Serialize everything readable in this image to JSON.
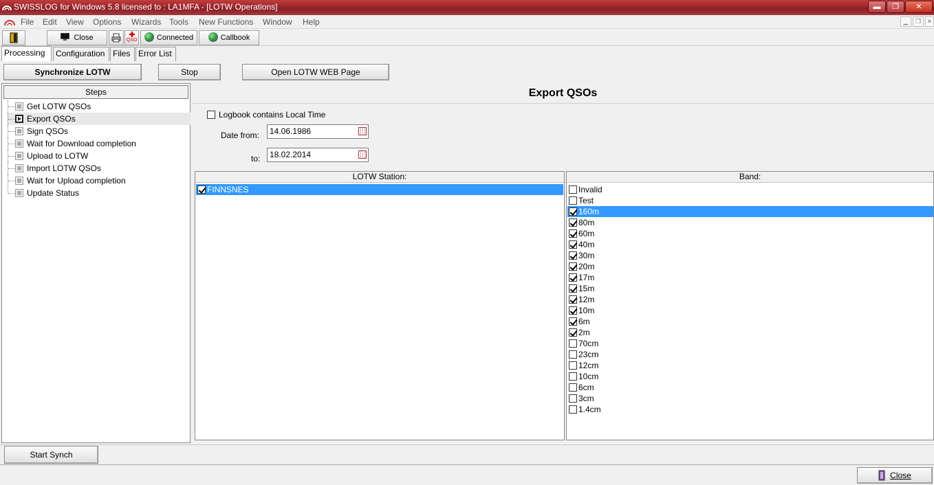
{
  "window": {
    "title": "SWISSLOG for Windows 5.8 licensed to : LA1MFA - [LOTW Operations]",
    "minimize": "▬",
    "maximize": "❐",
    "close": "✕"
  },
  "menu": [
    "File",
    "Edit",
    "View",
    "Options",
    "Wizards",
    "Tools",
    "New Functions",
    "Window",
    "Help"
  ],
  "toolbar": {
    "close_label": "Close",
    "connected_label": "Connected",
    "callbook_label": "Callbook",
    "qso_label": "QSO"
  },
  "tabs": [
    "Processing",
    "Configuration",
    "Files",
    "Error List"
  ],
  "actions": {
    "sync": "Synchronize  LOTW",
    "stop": "Stop",
    "open_web": "Open LOTW WEB Page"
  },
  "steps": {
    "header": "Steps",
    "items": [
      "Get LOTW QSOs",
      "Export QSOs",
      "Sign QSOs",
      "Wait for Download completion",
      "Upload to LOTW",
      "Import LOTW QSOs",
      "Wait for Upload completion",
      "Update Status"
    ],
    "active_index": 1
  },
  "export": {
    "title": "Export QSOs",
    "local_time_label": "Logbook contains Local Time",
    "local_time_checked": false,
    "date_from_label": "Date from:",
    "date_from": "14.06.1986",
    "date_to_label": "to:",
    "date_to": "18.02.2014"
  },
  "station": {
    "header": "LOTW Station:",
    "items": [
      {
        "label": "FINNSNES",
        "checked": true,
        "selected": true
      }
    ]
  },
  "band": {
    "header": "Band:",
    "items": [
      {
        "label": "Invalid",
        "checked": false
      },
      {
        "label": "Test",
        "checked": false
      },
      {
        "label": "160m",
        "checked": true,
        "selected": true
      },
      {
        "label": "80m",
        "checked": true
      },
      {
        "label": "60m",
        "checked": true
      },
      {
        "label": "40m",
        "checked": true
      },
      {
        "label": "30m",
        "checked": true
      },
      {
        "label": "20m",
        "checked": true
      },
      {
        "label": "17m",
        "checked": true
      },
      {
        "label": "15m",
        "checked": true
      },
      {
        "label": "12m",
        "checked": true
      },
      {
        "label": "10m",
        "checked": true
      },
      {
        "label": "6m",
        "checked": true
      },
      {
        "label": "2m",
        "checked": true
      },
      {
        "label": "70cm",
        "checked": false
      },
      {
        "label": "23cm",
        "checked": false
      },
      {
        "label": "12cm",
        "checked": false
      },
      {
        "label": "10cm",
        "checked": false
      },
      {
        "label": "6cm",
        "checked": false
      },
      {
        "label": "3cm",
        "checked": false
      },
      {
        "label": "1.4cm",
        "checked": false
      }
    ]
  },
  "footer": {
    "start_synch": "Start Synch",
    "close": "Close"
  }
}
